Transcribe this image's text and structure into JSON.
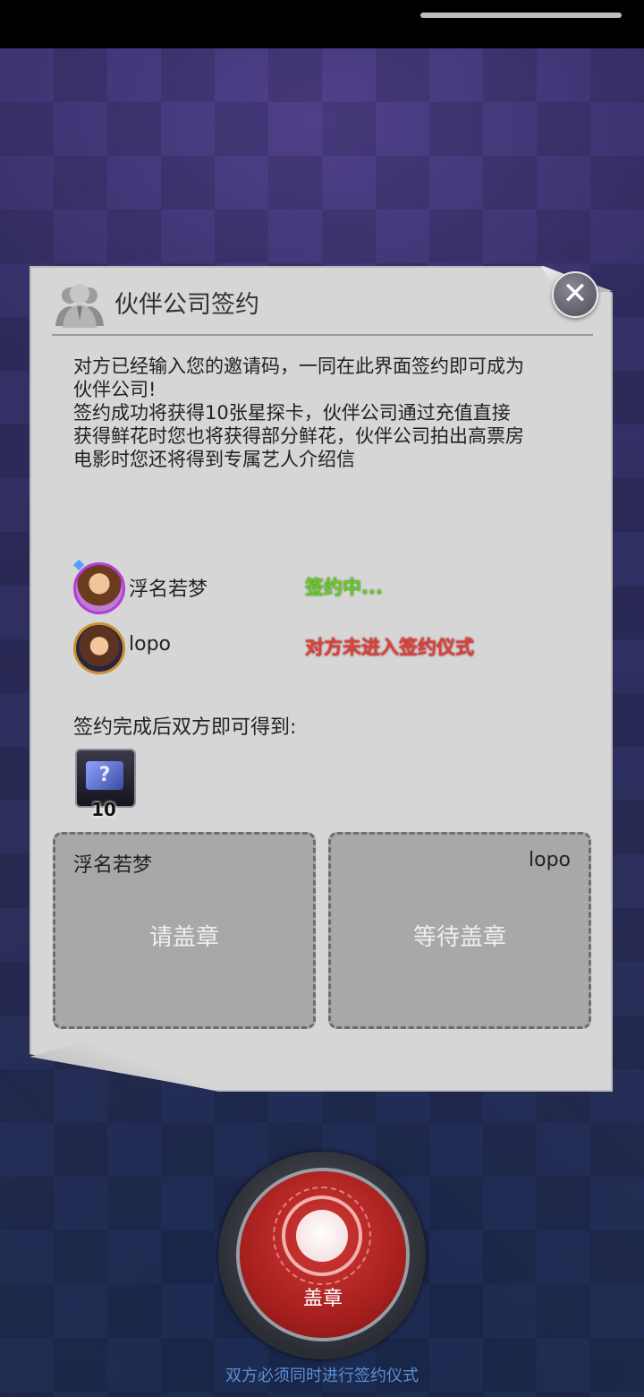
{
  "dialog": {
    "title": "伙伴公司签约",
    "close_icon": "close-icon",
    "description_lines": [
      "对方已经输入您的邀请码，一同在此界面签约即可成为",
      "伙伴公司!",
      "签约成功将获得10张星探卡，伙伴公司通过充值直接",
      "获得鲜花时您也将获得部分鲜花，伙伴公司拍出高票房",
      "电影时您还将得到专属艺人介绍信"
    ]
  },
  "parties": [
    {
      "name": "浮名若梦",
      "status": "签约中...",
      "status_color": "#66cc22"
    },
    {
      "name": "lopo",
      "status": "对方未进入签约仪式",
      "status_color": "#e0403a"
    }
  ],
  "reward": {
    "label": "签约完成后双方即可得到:",
    "item_icon": "scout-card-icon",
    "count": "10"
  },
  "stamp_boxes": {
    "left": {
      "name": "浮名若梦",
      "hint": "请盖章"
    },
    "right": {
      "name": "lopo",
      "hint": "等待盖章"
    }
  },
  "stamp_button": {
    "label": "盖章"
  },
  "footer_hint": "双方必须同时进行签约仪式"
}
